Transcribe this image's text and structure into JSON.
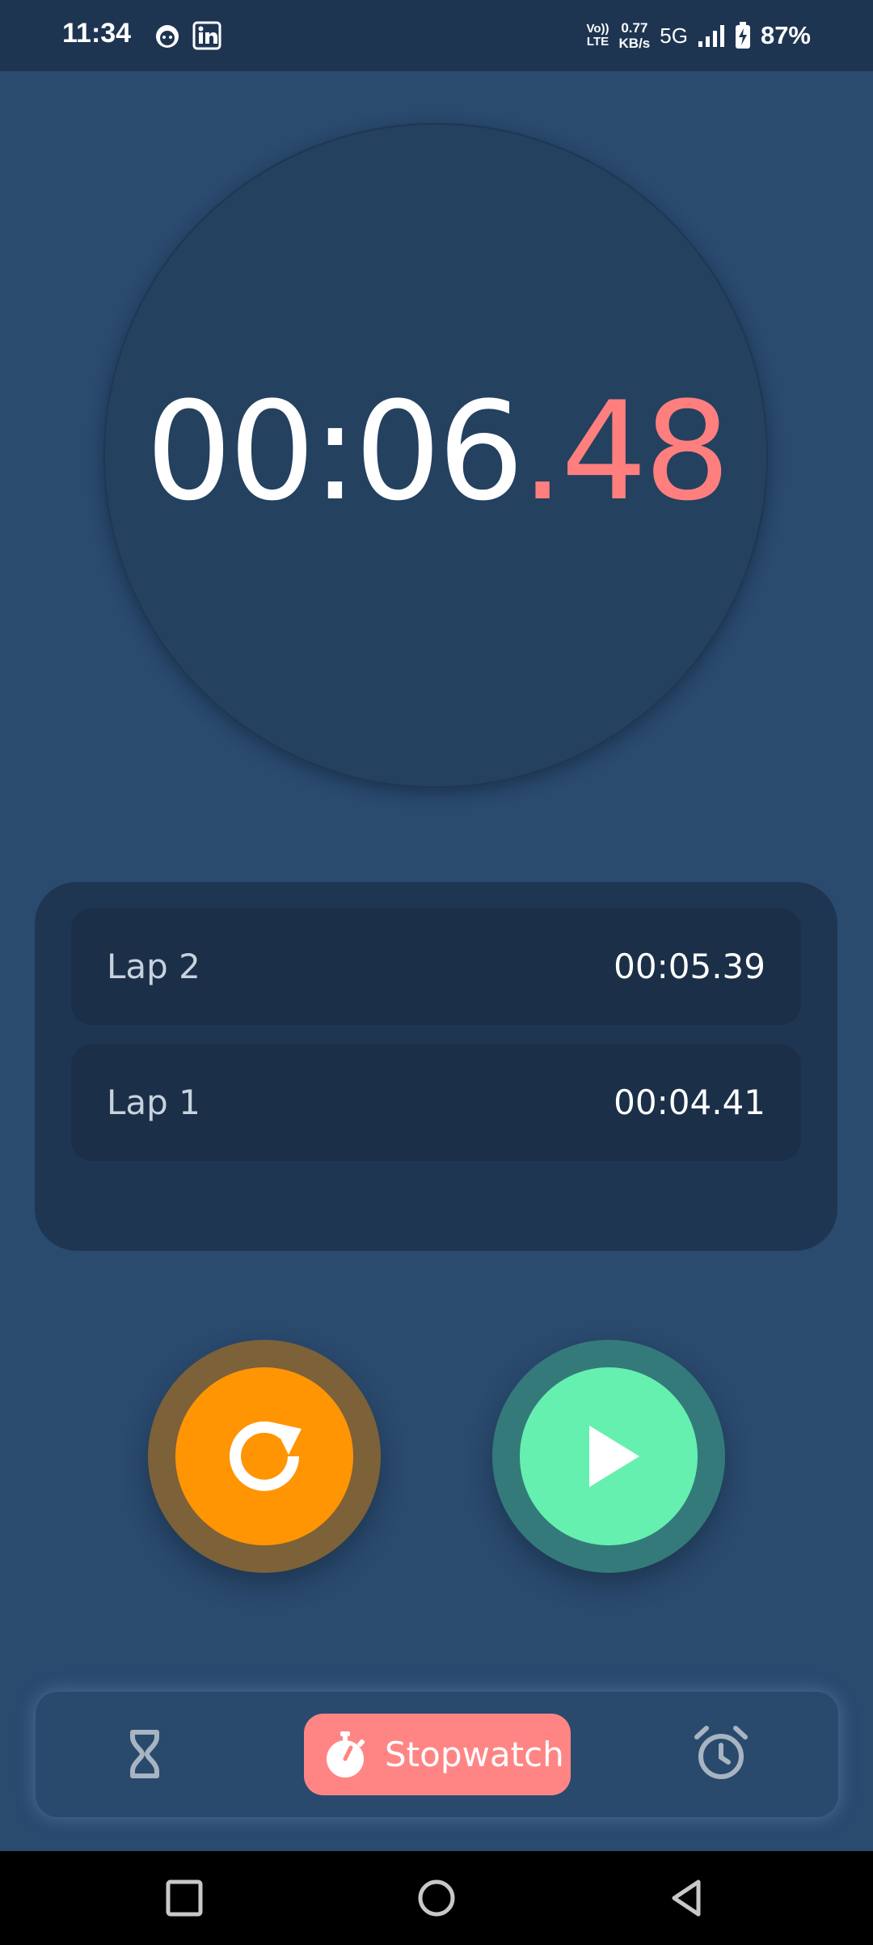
{
  "status_bar": {
    "time": "11:34",
    "left_icons": [
      "app-face-icon",
      "linkedin-icon"
    ],
    "volte_top": "Vo))",
    "volte_bottom": "LTE",
    "net_speed_value": "0.77",
    "net_speed_unit": "KB/s",
    "network": "5G",
    "battery": "87%"
  },
  "stopwatch": {
    "time_main": "00:06",
    "time_fraction": ".48",
    "accent_color": "#ff7f7f"
  },
  "laps": [
    {
      "label": "Lap 2",
      "time": "00:05.39"
    },
    {
      "label": "Lap 1",
      "time": "00:04.41"
    }
  ],
  "controls": {
    "reset_icon": "reset-icon",
    "reset_color": "#ff9503",
    "play_icon": "play-icon",
    "play_color": "#66f0b0"
  },
  "bottom_nav": {
    "items": [
      {
        "icon": "hourglass-icon",
        "label": ""
      },
      {
        "icon": "stopwatch-icon",
        "label": "Stopwatch",
        "active": true
      },
      {
        "icon": "alarm-clock-icon",
        "label": ""
      }
    ],
    "active_color": "#ff8585"
  },
  "system_nav": [
    "recent-apps-icon",
    "home-icon",
    "back-icon"
  ]
}
